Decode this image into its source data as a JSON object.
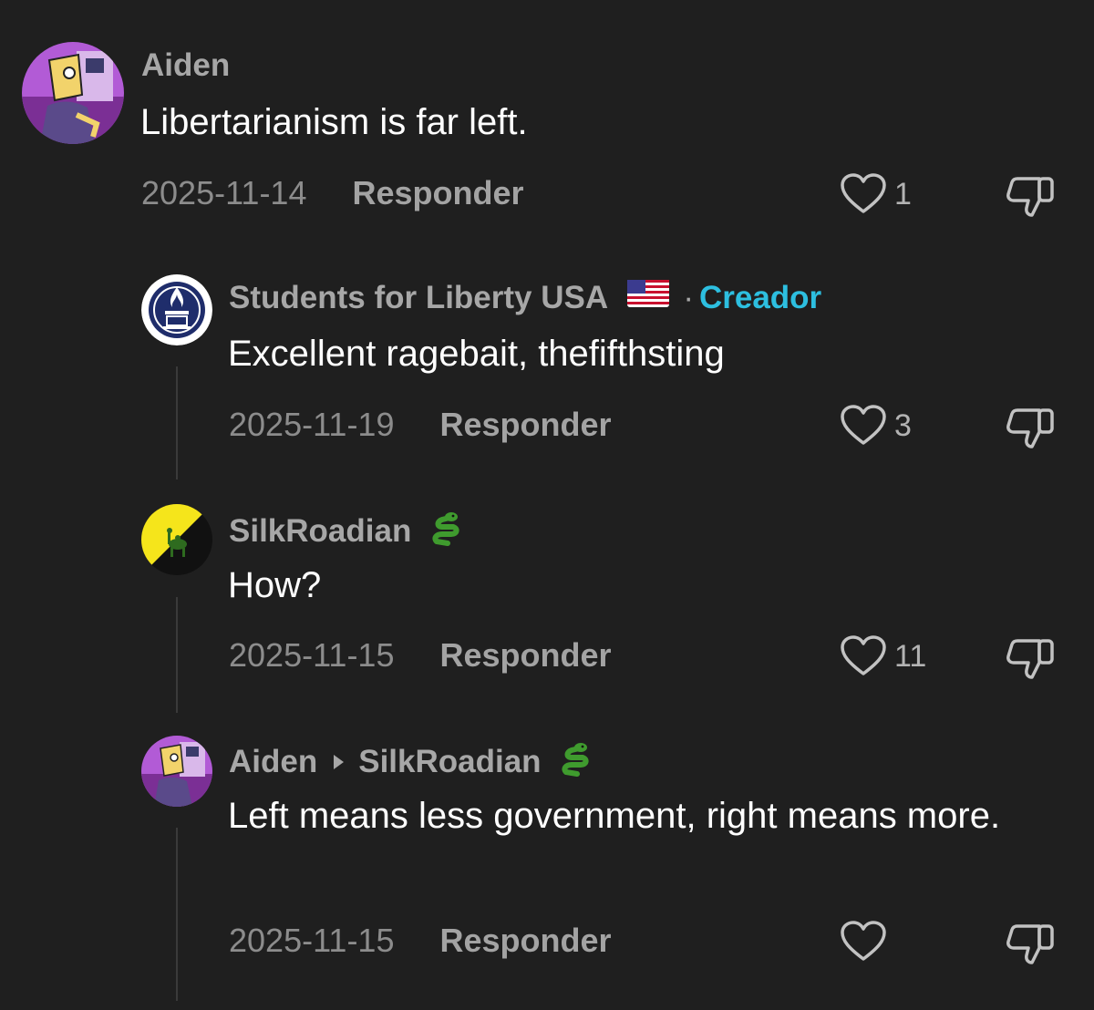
{
  "comments": [
    {
      "username": "Aiden",
      "text": "Libertarianism is far left.",
      "date": "2025-11-14",
      "reply_label": "Responder",
      "likes": "1"
    },
    {
      "username": "Students for Liberty USA",
      "flag": "🇺🇸",
      "separator": "·",
      "badge": "Creador",
      "text": "Excellent ragebait, thefifthsting",
      "date": "2025-11-19",
      "reply_label": "Responder",
      "likes": "3"
    },
    {
      "username": "SilkRoadian",
      "emoji": "🐍",
      "text": "How?",
      "date": "2025-11-15",
      "reply_label": "Responder",
      "likes": "11"
    },
    {
      "username": "Aiden",
      "reply_to": "SilkRoadian",
      "emoji": "🐍",
      "text": "Left means less government, right means more.",
      "date": "2025-11-15",
      "reply_label": "Responder",
      "likes": ""
    }
  ],
  "colors": {
    "background": "#1f1f1f",
    "creator_badge": "#2dbfe0",
    "username": "#a7a7a7"
  },
  "icons": [
    "heart-outline-icon",
    "thumbs-down-icon",
    "snake-emoji",
    "us-flag-emoji"
  ]
}
